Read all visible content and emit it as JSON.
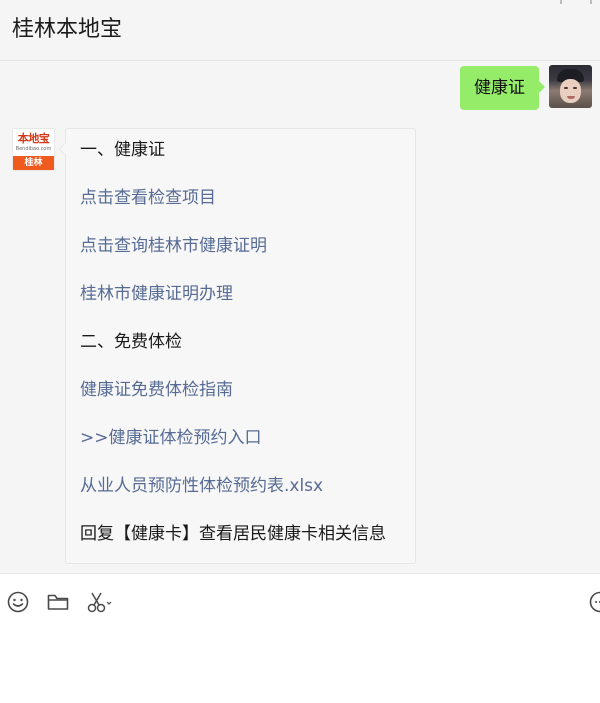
{
  "window": {
    "title": "桂林本地宝"
  },
  "avatar_brand": {
    "logo_text": "本地宝",
    "url_text": "Bendibao.com",
    "city": "桂林"
  },
  "messages": {
    "sent": {
      "text": "健康证"
    },
    "received": {
      "lines": [
        {
          "text": "一、健康证",
          "kind": "heading"
        },
        {
          "text": "点击查看检查项目",
          "kind": "link"
        },
        {
          "text": "点击查询桂林市健康证明",
          "kind": "link"
        },
        {
          "text": "桂林市健康证明办理",
          "kind": "link"
        },
        {
          "text": "二、免费体检",
          "kind": "heading"
        },
        {
          "text": "健康证免费体检指南",
          "kind": "link"
        },
        {
          "text": ">>健康证体检预约入口",
          "kind": "link"
        },
        {
          "text": "从业人员预防性体检预约表.xlsx",
          "kind": "link"
        },
        {
          "text": "回复【健康卡】查看居民健康卡相关信息",
          "kind": "text"
        }
      ]
    }
  },
  "toolbar": {
    "icons": [
      "emoji-icon",
      "folder-icon",
      "scissors-icon",
      "chat-history-icon"
    ]
  },
  "colors": {
    "sent_bubble": "#95ec69",
    "link": "#576b95",
    "chat_bg": "#f5f5f5",
    "brand_orange": "#ef5a1f"
  }
}
